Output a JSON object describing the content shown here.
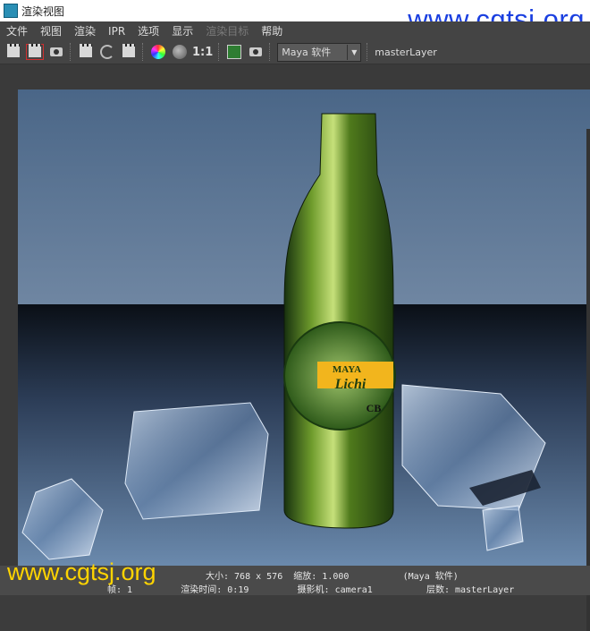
{
  "window": {
    "title": "渲染视图"
  },
  "watermarks": {
    "top": "www.cgtsj.org",
    "bottom": "www.cgtsj.org"
  },
  "menu": [
    {
      "label": "文件",
      "enabled": true
    },
    {
      "label": "视图",
      "enabled": true
    },
    {
      "label": "渲染",
      "enabled": true
    },
    {
      "label": "IPR",
      "enabled": true
    },
    {
      "label": "选项",
      "enabled": true
    },
    {
      "label": "显示",
      "enabled": true
    },
    {
      "label": "渲染目标",
      "enabled": false
    },
    {
      "label": "帮助",
      "enabled": true
    }
  ],
  "toolbar": {
    "ratio_label": "1:1",
    "renderer_select": "Maya 软件",
    "layer_label": "masterLayer"
  },
  "render_image": {
    "bottle_label_top": "MAYA",
    "bottle_label_script": "Lichi",
    "bottle_label_code": "CB"
  },
  "status": {
    "line1": "大小: 768 x 576  缩放: 1.000          (Maya 软件)",
    "line2": "帧: 1         渲染时间: 0:19         摄影机: camera1          层数: masterLayer"
  },
  "colors": {
    "watermark_top": "#1a3fe0",
    "watermark_bottom": "#ffd400"
  }
}
